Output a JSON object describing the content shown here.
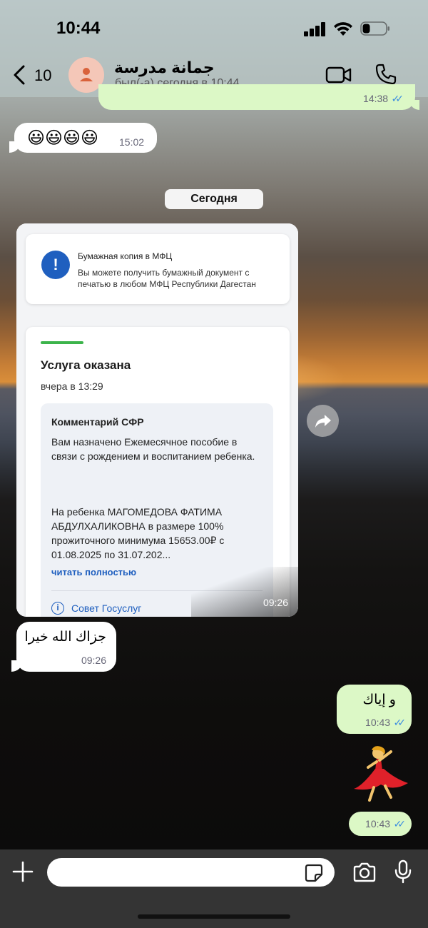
{
  "status_bar": {
    "time": "10:44"
  },
  "header": {
    "back_count": "10",
    "chat_name": "جمانة مدرسة",
    "chat_status": "был(-а) сегодня в 10:44"
  },
  "messages": {
    "prev_out_time": "14:38",
    "prev_out_ticks": "✓✓",
    "emoji_text": "😃😃😃😃",
    "emoji_time": "15:02",
    "date_separator": "Сегодня",
    "image": {
      "card1_title": "Бумажная копия в МФЦ",
      "card1_body": "Вы можете получить бумажный документ с печатью в любом МФЦ Республики Дагестан",
      "status_title": "Услуга оказана",
      "status_date": "вчера в 13:29",
      "comment_title": "Комментарий СФР",
      "comment_p1": "Вам назначено Ежемесячное пособие в связи с рождением и воспитанием ребенка.",
      "comment_p2": "На ребенка МАГОМЕДОВА ФАТИМА АБДУЛХАЛИКОВНА в размере 100% прожиточного минимума 15653.00₽ с 01.08.2025 по 31.07.202...",
      "read_more": "читать полностью",
      "advice_icon": "i",
      "advice_label": "Совет Госуслуг",
      "time": "09:26"
    },
    "arabic_in_text": "جزاك الله خيرا",
    "arabic_in_time": "09:26",
    "arabic_out_text": "و إياك",
    "arabic_out_time": "10:43",
    "arabic_out_ticks": "✓✓",
    "sticker": "💃",
    "sticker_time": "10:43",
    "sticker_ticks": "✓✓"
  },
  "input": {
    "placeholder": "",
    "value": ""
  },
  "icons": {
    "info": "!"
  },
  "colors": {
    "outgoing_bubble": "#dcf8c6",
    "incoming_bubble": "#ffffff",
    "read_ticks": "#3b8de0",
    "gosuslugi_blue": "#1f5fbf",
    "success_green": "#3cb44b"
  }
}
